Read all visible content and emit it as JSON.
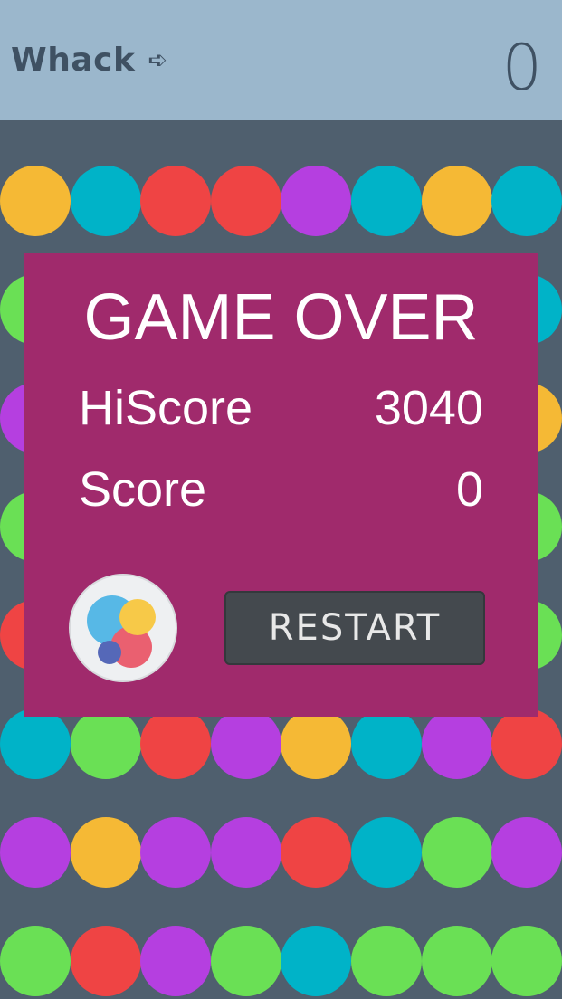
{
  "header": {
    "title": "Whack",
    "arrow": "➪",
    "score": "0"
  },
  "game_over": {
    "title": "GAME OVER",
    "hiscore_label": "HiScore",
    "hiscore_value": "3040",
    "score_label": "Score",
    "score_value": "0",
    "restart_label": "RESTART"
  },
  "palette": {
    "Y": "#f5b935",
    "C": "#00b3c8",
    "R": "#ef4444",
    "P": "#b53fe0",
    "G": "#6ae055"
  },
  "board_rows": [
    [
      "Y",
      "C",
      "R",
      "R",
      "P",
      "C",
      "Y",
      "C"
    ],
    [
      "G",
      "",
      "",
      "",
      "",
      "",
      "",
      "C"
    ],
    [
      "P",
      "",
      "",
      "",
      "",
      "",
      "",
      "Y"
    ],
    [
      "G",
      "",
      "",
      "",
      "",
      "",
      "",
      "G"
    ],
    [
      "R",
      "",
      "",
      "",
      "",
      "",
      "",
      "G"
    ],
    [
      "C",
      "G",
      "R",
      "P",
      "Y",
      "C",
      "P",
      "R"
    ],
    [
      "P",
      "Y",
      "P",
      "P",
      "R",
      "C",
      "G",
      "P"
    ],
    [
      "G",
      "R",
      "P",
      "G",
      "C",
      "G",
      "G",
      "G"
    ]
  ]
}
